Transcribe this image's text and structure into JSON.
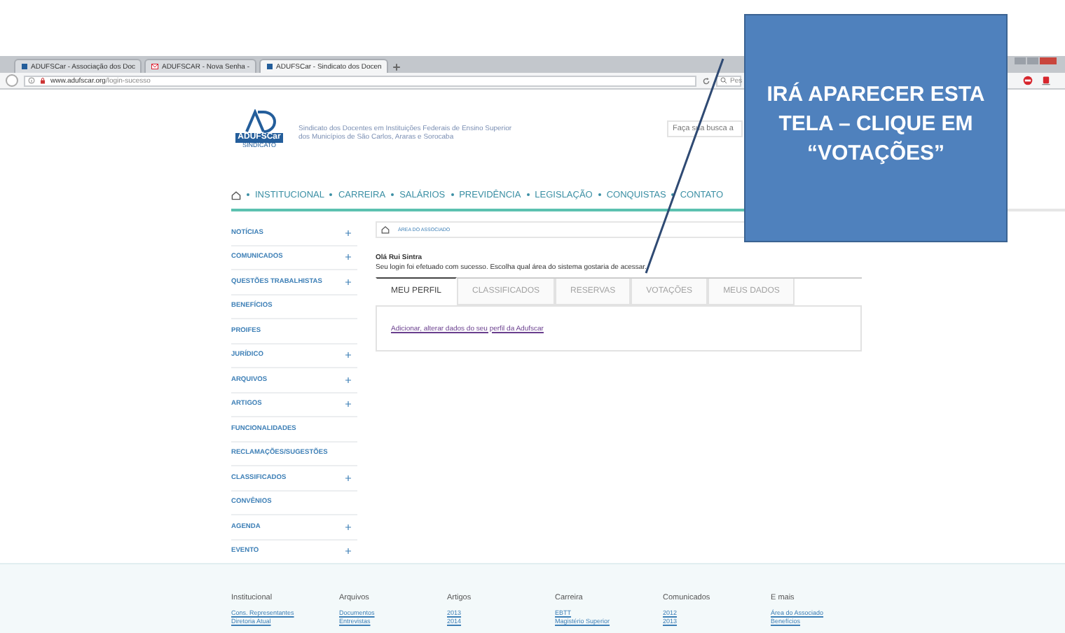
{
  "browser": {
    "tabs": [
      {
        "label": "ADUFSCar - Associação dos Doc",
        "selected": false,
        "kind": "page"
      },
      {
        "label": "ADUFSCAR - Nova Senha - ",
        "selected": false,
        "kind": "mail"
      },
      {
        "label": "ADUFSCar - Sindicato dos Docen",
        "selected": true,
        "kind": "page"
      }
    ],
    "url_host": "www.adufscar.org",
    "url_path": "/login-sucesso",
    "search_placeholder": "Pes"
  },
  "site": {
    "logo_text": "ADUFSCar",
    "logo_sub": "SINDICATO",
    "tagline": [
      "Sindicato dos Docentes em Instituições Federais de Ensino Superior",
      "dos Municípios de São Carlos, Araras e Sorocaba"
    ],
    "search_placeholder": "Faça sua busca a",
    "nav": [
      "INSTITUCIONAL",
      "CARREIRA",
      "SALÁRIOS",
      "PREVIDÊNCIA",
      "LEGISLAÇÃO",
      "CONQUISTAS",
      "CONTATO"
    ]
  },
  "sidebar": {
    "items": [
      {
        "label": "NOTÍCIAS",
        "expandable": true
      },
      {
        "label": "COMUNICADOS",
        "expandable": true
      },
      {
        "label": "QUESTÕES TRABALHISTAS",
        "expandable": true
      },
      {
        "label": "BENEFÍCIOS",
        "expandable": false
      },
      {
        "label": "PROIFES",
        "expandable": false
      },
      {
        "label": "JURÍDICO",
        "expandable": true
      },
      {
        "label": "ARQUIVOS",
        "expandable": true
      },
      {
        "label": "ARTIGOS",
        "expandable": true
      },
      {
        "label": "FUNCIONALIDADES",
        "expandable": false
      },
      {
        "label": "RECLAMAÇÕES/SUGESTÕES",
        "expandable": false
      },
      {
        "label": "CLASSIFICADOS",
        "expandable": true
      },
      {
        "label": "CONVÊNIOS",
        "expandable": false
      },
      {
        "label": "AGENDA",
        "expandable": true
      },
      {
        "label": "EVENTO",
        "expandable": true
      }
    ]
  },
  "main": {
    "breadcrumb": "ÁREA DO ASSOCIADO",
    "greeting": "Olá Rui Sintra",
    "message": "Seu login foi efetuado com sucesso. Escolha qual área do sistema gostaria de acessar.",
    "tabs": [
      {
        "label": "MEU PERFIL",
        "selected": true
      },
      {
        "label": "CLASSIFICADOS",
        "selected": false
      },
      {
        "label": "RESERVAS",
        "selected": false
      },
      {
        "label": "VOTAÇÕES",
        "selected": false
      },
      {
        "label": "MEUS DADOS",
        "selected": false
      }
    ],
    "panel_link": "Adicionar, alterar dados do seu perfil da Adufscar"
  },
  "footer": {
    "columns": [
      {
        "heading": "Institucional",
        "links": [
          "Cons. Representantes",
          "Diretoria Atual"
        ]
      },
      {
        "heading": "Arquivos",
        "links": [
          "Documentos",
          "Entrevistas"
        ]
      },
      {
        "heading": "Artigos",
        "links": [
          "2013",
          "2014"
        ]
      },
      {
        "heading": "Carreira",
        "links": [
          "EBTT",
          "Magistério Superior"
        ]
      },
      {
        "heading": "Comunicados",
        "links": [
          "2012",
          "2013"
        ]
      },
      {
        "heading": "E mais",
        "links": [
          "Área do Associado",
          "Benefícios"
        ]
      }
    ]
  },
  "callout": {
    "text": "IRÁ APARECER ESTA TELA – CLIQUE EM “VOTAÇÕES”"
  }
}
